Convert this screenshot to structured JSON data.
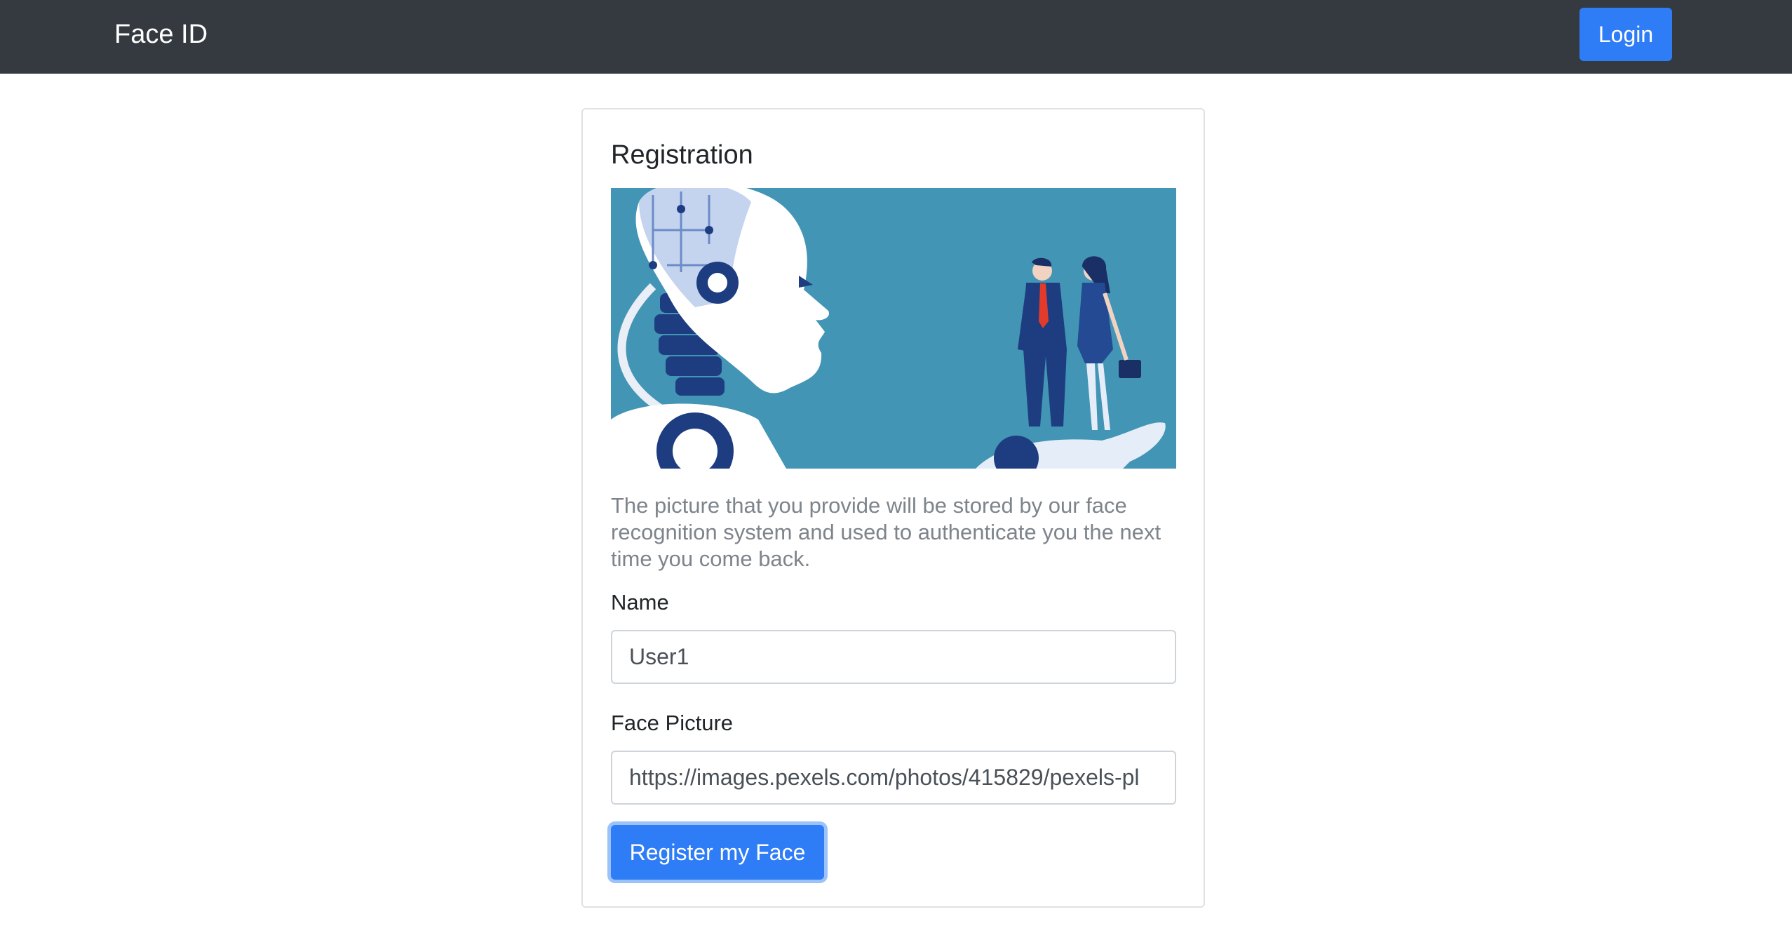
{
  "navbar": {
    "brand": "Face ID",
    "login_label": "Login"
  },
  "card": {
    "title": "Registration",
    "image_alt": "robot-and-business-people-illustration",
    "description": "The picture that you provide will be stored by our face recognition system and used to authenticate you the next time you come back."
  },
  "form": {
    "name_label": "Name",
    "name_value": "User1",
    "face_label": "Face Picture",
    "face_value": "https://images.pexels.com/photos/415829/pexels-pl",
    "submit_label": "Register my Face"
  },
  "colors": {
    "navbar_bg": "#343a40",
    "primary": "#2f7df6",
    "hero_bg": "#4295b5"
  }
}
